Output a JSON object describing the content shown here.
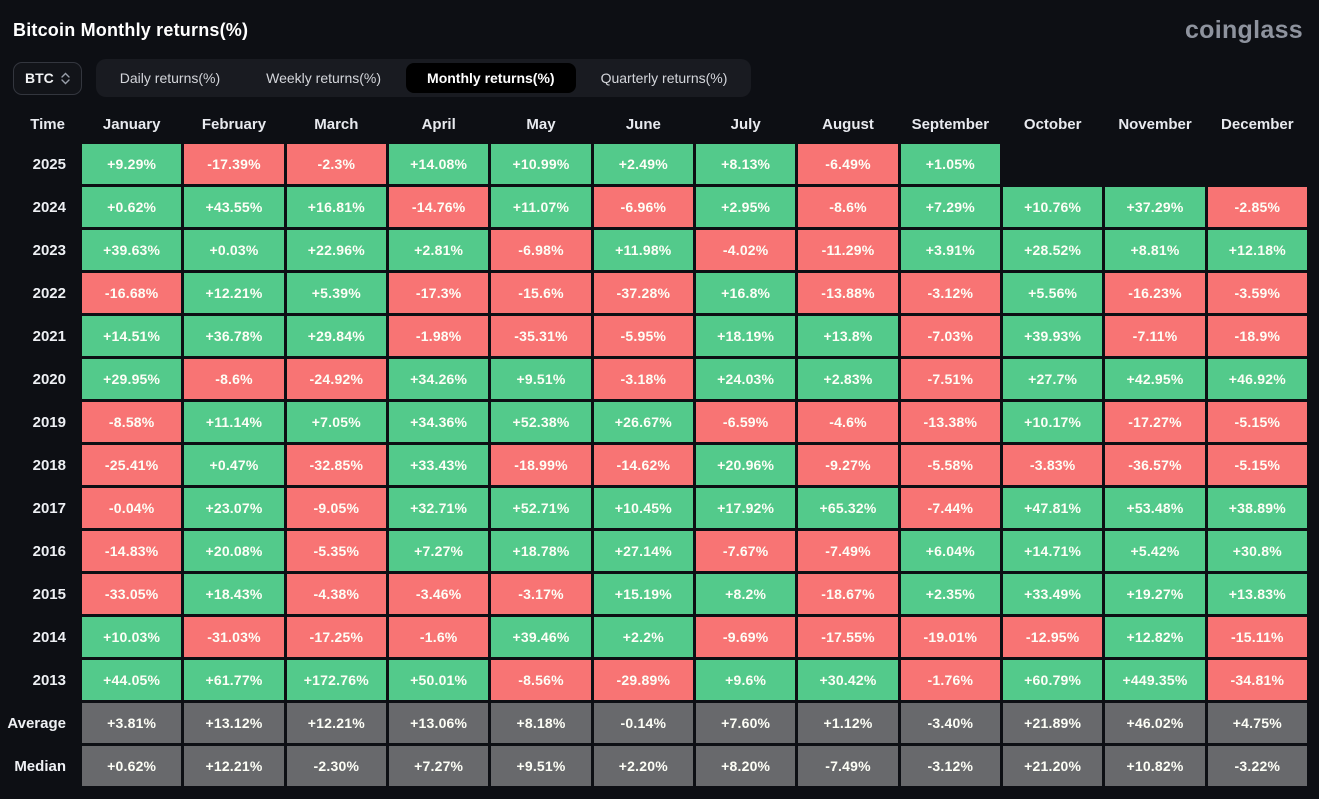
{
  "page": {
    "title": "Bitcoin Monthly returns(%)",
    "logo": "coinglass"
  },
  "controls": {
    "symbol_select": {
      "value": "BTC"
    },
    "tabs": [
      {
        "label": "Daily returns(%)",
        "active": false
      },
      {
        "label": "Weekly returns(%)",
        "active": false
      },
      {
        "label": "Monthly returns(%)",
        "active": true
      },
      {
        "label": "Quarterly returns(%)",
        "active": false
      }
    ]
  },
  "colors": {
    "positive": "#53ca8b",
    "negative": "#f87474",
    "summary": "#68696c",
    "background": "#0d0f14",
    "active_tab": "#000000"
  },
  "table": {
    "time_header": "Time",
    "month_headers": [
      "January",
      "February",
      "March",
      "April",
      "May",
      "June",
      "July",
      "August",
      "September",
      "October",
      "November",
      "December"
    ],
    "rows": [
      {
        "label": "2025",
        "type": "year",
        "values": [
          "+9.29%",
          "-17.39%",
          "-2.3%",
          "+14.08%",
          "+10.99%",
          "+2.49%",
          "+8.13%",
          "-6.49%",
          "+1.05%",
          null,
          null,
          null
        ]
      },
      {
        "label": "2024",
        "type": "year",
        "values": [
          "+0.62%",
          "+43.55%",
          "+16.81%",
          "-14.76%",
          "+11.07%",
          "-6.96%",
          "+2.95%",
          "-8.6%",
          "+7.29%",
          "+10.76%",
          "+37.29%",
          "-2.85%"
        ]
      },
      {
        "label": "2023",
        "type": "year",
        "values": [
          "+39.63%",
          "+0.03%",
          "+22.96%",
          "+2.81%",
          "-6.98%",
          "+11.98%",
          "-4.02%",
          "-11.29%",
          "+3.91%",
          "+28.52%",
          "+8.81%",
          "+12.18%"
        ]
      },
      {
        "label": "2022",
        "type": "year",
        "values": [
          "-16.68%",
          "+12.21%",
          "+5.39%",
          "-17.3%",
          "-15.6%",
          "-37.28%",
          "+16.8%",
          "-13.88%",
          "-3.12%",
          "+5.56%",
          "-16.23%",
          "-3.59%"
        ]
      },
      {
        "label": "2021",
        "type": "year",
        "values": [
          "+14.51%",
          "+36.78%",
          "+29.84%",
          "-1.98%",
          "-35.31%",
          "-5.95%",
          "+18.19%",
          "+13.8%",
          "-7.03%",
          "+39.93%",
          "-7.11%",
          "-18.9%"
        ]
      },
      {
        "label": "2020",
        "type": "year",
        "values": [
          "+29.95%",
          "-8.6%",
          "-24.92%",
          "+34.26%",
          "+9.51%",
          "-3.18%",
          "+24.03%",
          "+2.83%",
          "-7.51%",
          "+27.7%",
          "+42.95%",
          "+46.92%"
        ]
      },
      {
        "label": "2019",
        "type": "year",
        "values": [
          "-8.58%",
          "+11.14%",
          "+7.05%",
          "+34.36%",
          "+52.38%",
          "+26.67%",
          "-6.59%",
          "-4.6%",
          "-13.38%",
          "+10.17%",
          "-17.27%",
          "-5.15%"
        ]
      },
      {
        "label": "2018",
        "type": "year",
        "values": [
          "-25.41%",
          "+0.47%",
          "-32.85%",
          "+33.43%",
          "-18.99%",
          "-14.62%",
          "+20.96%",
          "-9.27%",
          "-5.58%",
          "-3.83%",
          "-36.57%",
          "-5.15%"
        ]
      },
      {
        "label": "2017",
        "type": "year",
        "values": [
          "-0.04%",
          "+23.07%",
          "-9.05%",
          "+32.71%",
          "+52.71%",
          "+10.45%",
          "+17.92%",
          "+65.32%",
          "-7.44%",
          "+47.81%",
          "+53.48%",
          "+38.89%"
        ]
      },
      {
        "label": "2016",
        "type": "year",
        "values": [
          "-14.83%",
          "+20.08%",
          "-5.35%",
          "+7.27%",
          "+18.78%",
          "+27.14%",
          "-7.67%",
          "-7.49%",
          "+6.04%",
          "+14.71%",
          "+5.42%",
          "+30.8%"
        ]
      },
      {
        "label": "2015",
        "type": "year",
        "values": [
          "-33.05%",
          "+18.43%",
          "-4.38%",
          "-3.46%",
          "-3.17%",
          "+15.19%",
          "+8.2%",
          "-18.67%",
          "+2.35%",
          "+33.49%",
          "+19.27%",
          "+13.83%"
        ]
      },
      {
        "label": "2014",
        "type": "year",
        "values": [
          "+10.03%",
          "-31.03%",
          "-17.25%",
          "-1.6%",
          "+39.46%",
          "+2.2%",
          "-9.69%",
          "-17.55%",
          "-19.01%",
          "-12.95%",
          "+12.82%",
          "-15.11%"
        ]
      },
      {
        "label": "2013",
        "type": "year",
        "values": [
          "+44.05%",
          "+61.77%",
          "+172.76%",
          "+50.01%",
          "-8.56%",
          "-29.89%",
          "+9.6%",
          "+30.42%",
          "-1.76%",
          "+60.79%",
          "+449.35%",
          "-34.81%"
        ]
      },
      {
        "label": "Average",
        "type": "summary",
        "values": [
          "+3.81%",
          "+13.12%",
          "+12.21%",
          "+13.06%",
          "+8.18%",
          "-0.14%",
          "+7.60%",
          "+1.12%",
          "-3.40%",
          "+21.89%",
          "+46.02%",
          "+4.75%"
        ]
      },
      {
        "label": "Median",
        "type": "summary",
        "values": [
          "+0.62%",
          "+12.21%",
          "-2.30%",
          "+7.27%",
          "+9.51%",
          "+2.20%",
          "+8.20%",
          "-7.49%",
          "-3.12%",
          "+21.20%",
          "+10.82%",
          "-3.22%"
        ]
      }
    ]
  }
}
